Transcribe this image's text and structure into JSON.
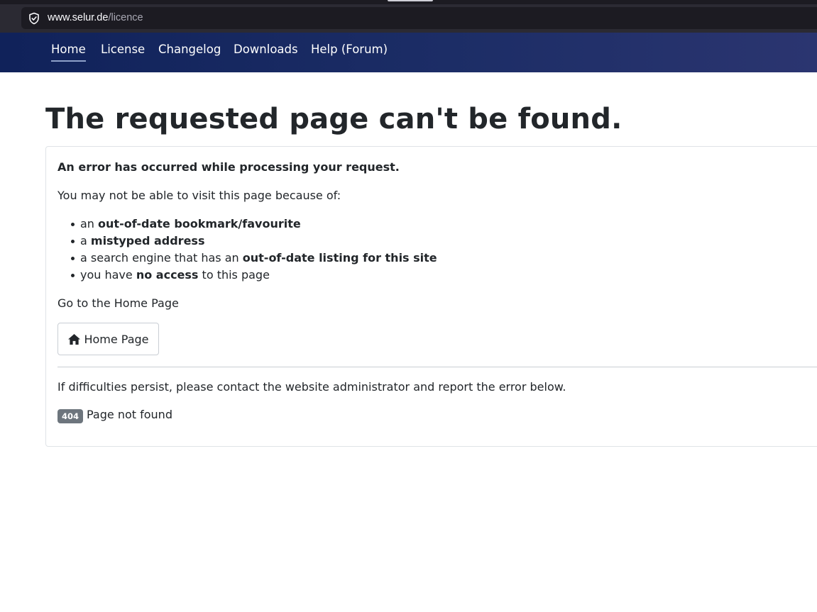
{
  "browser": {
    "url_host": "www.selur.de",
    "url_path": "/licence"
  },
  "nav": {
    "items": [
      {
        "label": "Home",
        "active": true
      },
      {
        "label": "License"
      },
      {
        "label": "Changelog"
      },
      {
        "label": "Downloads"
      },
      {
        "label": "Help (Forum)"
      }
    ]
  },
  "page": {
    "title": "The requested page can't be found."
  },
  "error": {
    "heading": "An error has occurred while processing your request.",
    "intro": "You may not be able to visit this page because of:",
    "reasons": [
      {
        "pre": "an ",
        "strong": "out-of-date bookmark/favourite",
        "post": ""
      },
      {
        "pre": "a ",
        "strong": "mistyped address",
        "post": ""
      },
      {
        "pre": "a search engine that has an ",
        "strong": "out-of-date listing for this site",
        "post": ""
      },
      {
        "pre": "you have ",
        "strong": "no access",
        "post": " to this page"
      }
    ],
    "goto_text": "Go to the Home Page",
    "home_button_label": "Home Page",
    "persist_text": "If difficulties persist, please contact the website administrator and report the error below.",
    "code": "404",
    "code_message": "Page not found"
  },
  "colors": {
    "navbar": "#1c2d66",
    "badge": "#6d757d",
    "text": "#22262a"
  },
  "icons": {
    "address_bar": "shield-icon",
    "home_button": "home-icon"
  }
}
